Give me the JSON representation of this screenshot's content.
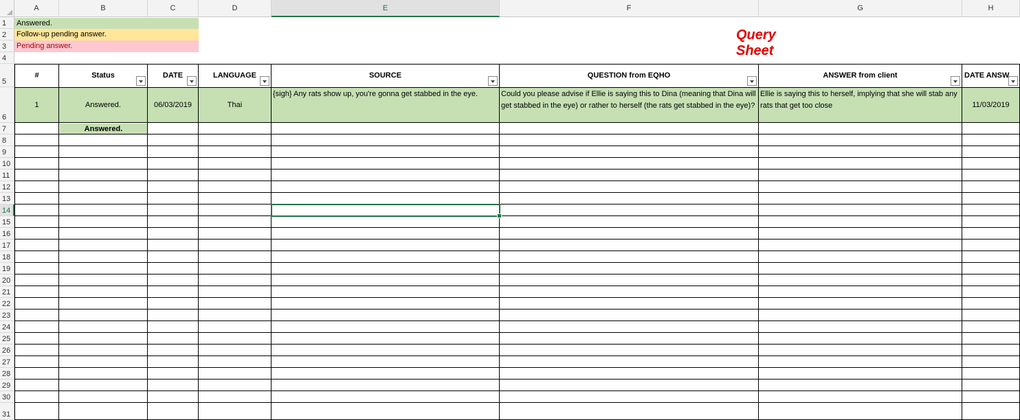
{
  "columns": [
    "A",
    "B",
    "C",
    "D",
    "E",
    "F",
    "G",
    "H"
  ],
  "selected_column": "E",
  "selected_row": "14",
  "rows": [
    "1",
    "2",
    "3",
    "4",
    "5",
    "6",
    "7",
    "8",
    "9",
    "10",
    "11",
    "12",
    "13",
    "14",
    "15",
    "16",
    "17",
    "18",
    "19",
    "20",
    "21",
    "22",
    "23",
    "24",
    "25",
    "26",
    "27",
    "28",
    "29",
    "30",
    "31"
  ],
  "legend": {
    "answered": {
      "label": "Answered.",
      "color": "#c6e0b4"
    },
    "followup": {
      "label": "Follow-up pending answer.",
      "color": "#ffe699"
    },
    "pending": {
      "label": "Pending answer.",
      "color": "#ffc7ce"
    }
  },
  "sheet_title": "Query Sheet",
  "table": {
    "headers": [
      "#",
      "Status",
      "DATE",
      "LANGUAGE",
      "SOURCE",
      "QUESTION from EQHO",
      "ANSWER from client",
      "DATE ANSW"
    ],
    "row6": {
      "num": "1",
      "status": "Answered.",
      "date": "06/03/2019",
      "language": "Thai",
      "source": "{sigh} Any rats show up, you're gonna get stabbed in the eye.",
      "question": "Could you please advise if Ellie is saying this to Dina (meaning that Dina will get stabbed in the eye) or rather to herself (the rats get stabbed in the eye)?",
      "answer": "Ellie is saying this to herself, implying that she will stab any rats that get too close",
      "date_answered": "11/03/2019"
    },
    "row7_status": "Answered."
  }
}
